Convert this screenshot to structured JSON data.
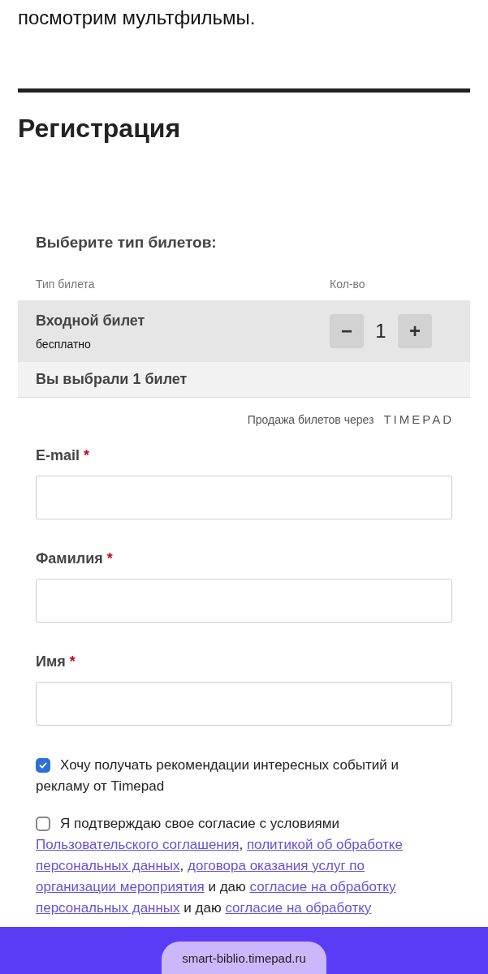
{
  "intro_text": "посмотрим мультфильмы.",
  "registration": {
    "title": "Регистрация",
    "tickets": {
      "title": "Выберите тип билетов:",
      "columns": [
        "Тип билета",
        "Кол-во"
      ],
      "rows": [
        {
          "name": "Входной билет",
          "price": "бесплатно",
          "decrement": "−",
          "quantity": "1",
          "increment": "+"
        }
      ],
      "summary": "Вы выбрали 1 билет"
    },
    "sales_note": "Продажа билетов через",
    "sales_logo": "TIMEPAD",
    "fields": [
      {
        "label": "E-mail",
        "required_mark": "*"
      },
      {
        "label": "Фамилия",
        "required_mark": "*"
      },
      {
        "label": "Имя",
        "required_mark": "*"
      }
    ],
    "consents": [
      {
        "checked": true,
        "lines": [
          [
            {
              "kind": "text",
              "text": "Хочу получать рекомендации интересных событий и"
            }
          ],
          [
            {
              "kind": "text",
              "text": "рекламу от Timepad"
            }
          ]
        ]
      },
      {
        "checked": false,
        "lines": [
          [
            {
              "kind": "text",
              "text": "Я подтверждаю свое согласие с условиями"
            }
          ],
          [
            {
              "kind": "link",
              "text": "Пользовательского соглашения"
            },
            {
              "kind": "text",
              "text": ", "
            },
            {
              "kind": "link",
              "text": "политикой об обработке"
            }
          ],
          [
            {
              "kind": "link",
              "text": "персональных данных"
            },
            {
              "kind": "text",
              "text": ", "
            },
            {
              "kind": "link",
              "text": "договора оказания услуг по"
            }
          ],
          [
            {
              "kind": "link",
              "text": "организации мероприятия"
            },
            {
              "kind": "text",
              "text": " и даю "
            },
            {
              "kind": "link",
              "text": "согласие на обработку"
            }
          ],
          [
            {
              "kind": "link",
              "text": "персональных данных"
            },
            {
              "kind": "text",
              "text": " и даю "
            },
            {
              "kind": "link",
              "text": "согласие на обработку"
            }
          ]
        ]
      }
    ]
  },
  "address_bar": {
    "url": "smart-biblio.timepad.ru"
  }
}
